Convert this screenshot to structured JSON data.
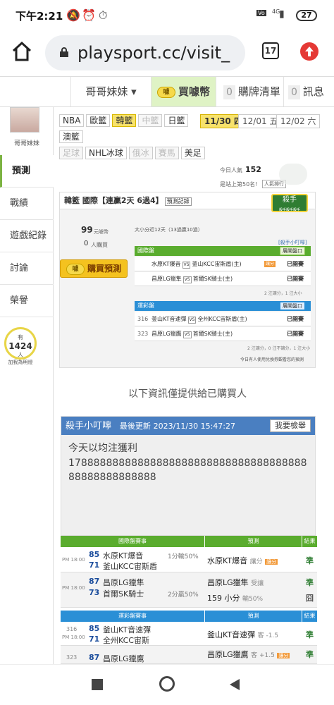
{
  "status_bar": {
    "time": "下午2:21",
    "battery": "27",
    "network": "4G"
  },
  "browser": {
    "url": "playsport.cc/visit_",
    "tab_count": "17"
  },
  "top_nav": {
    "user_menu": "哥哥妹妹 ▾",
    "buy_coins": "買噱幣",
    "buy_coins_icon_text": "噱",
    "cart_count": "0",
    "cart_label": "購牌清單",
    "msg_count": "0",
    "msg_label": "訊息"
  },
  "sidebar": {
    "username": "哥哥妹妹",
    "items": [
      {
        "label": "預測"
      },
      {
        "label": "戰績"
      },
      {
        "label": "遊戲紀錄"
      },
      {
        "label": "討論"
      },
      {
        "label": "榮譽"
      }
    ],
    "fans_prefix": "有",
    "fans_count": "1424",
    "fans_unit": "人",
    "fans_suffix": "加我為明燈"
  },
  "sports_row1": [
    "NBA",
    "歐籃",
    "韓籃",
    "中籃",
    "日籃"
  ],
  "sports_row2": [
    "澳籃"
  ],
  "sports_row3": [
    "足球",
    "NHL冰球",
    "俄冰",
    "賽馬",
    "美足"
  ],
  "dates": [
    "11/30 四",
    "12/01 五",
    "12/02 六"
  ],
  "popularity": {
    "label": "今日人氣",
    "value": "152",
    "rank_text": "是站上第50名!",
    "ranking_link": "人氣排行"
  },
  "panel": {
    "league": "韓籃 國際",
    "streak": "【連贏2天 6過4】",
    "record_btn": "預測記錄",
    "badge_title": "殺手",
    "badge_sub": "殺手殺手殺手",
    "price": "99",
    "price_unit": "元噱幣",
    "buyers": "0",
    "buyers_unit": "人購買",
    "buy_btn": "購買預測",
    "summary": "大小分近12天（13過贏10過）",
    "killer_link": "[殺手小叮嚀]",
    "intl_head": "國際盤",
    "expand1": "展開盤口",
    "intl_rows": [
      {
        "home": "水原KT爆音",
        "away": "釜山KCC宙斯盾(主)",
        "tag": "讓分",
        "status": "已開賽"
      },
      {
        "home": "昌原LG獵隼",
        "away": "首爾SK騎士(主)",
        "tag": "",
        "status": "已開賽"
      }
    ],
    "intl_foot": "2 注讓分，1 注大小",
    "sport_head": "運彩盤",
    "expand2": "展開盤口",
    "sport_rows": [
      {
        "no": "316",
        "home": "釜山KT音速彈",
        "away": "全州KCC宙斯盾(主)",
        "status": "已開賽"
      },
      {
        "no": "323",
        "home": "昌原LG獵鷹",
        "away": "首爾SK騎士(主)",
        "status": "已開賽"
      }
    ],
    "sport_foot": "2 注讓分，0 注不讓分，1 注大小",
    "footer": "今日有人使用兌換券觀看您的預測"
  },
  "notice": "以下資訊僅提供給已購買人",
  "killer": {
    "title": "殺手小叮嚀",
    "updated_label": "最後更新",
    "updated": "2023/11/30 15:47:27",
    "report_btn": "我要檢舉",
    "line1": "今天以均注獲利",
    "line2": "1788888888888888888888888888888888888888888888888888"
  },
  "intl_table": {
    "head_game": "國際盤賽事",
    "head_pred": "預測",
    "head_res": "結果",
    "rows": [
      {
        "time": "PM 18:00",
        "s1": "85",
        "t1": "水原KT爆音",
        "s2": "71",
        "t2": "釜山KCC宙斯盾",
        "extra": "1分輸50%",
        "pred": "水原KT爆音",
        "pred_note": "讓分",
        "pred_tag": "讓分",
        "res": "準"
      },
      {
        "time": "PM 18:00",
        "s1": "87",
        "t1": "昌原LG獵隼",
        "s2": "73",
        "t2": "首爾SK騎士",
        "extra": "2分贏50%",
        "pred": "昌原LG獵隼",
        "pred_note": "受讓",
        "pred2": "159 小分",
        "pred2_note": "輸50%",
        "res": "準",
        "res2": "囧"
      }
    ]
  },
  "sport_table": {
    "head_game": "運彩盤賽事",
    "head_pred": "預測",
    "head_res": "結果",
    "rows": [
      {
        "no": "316",
        "time": "PM 18:00",
        "s1": "85",
        "t1": "釜山KT音速彈",
        "s2": "71",
        "t2": "全州KCC宙斯",
        "pred": "釜山KT音速彈",
        "pred_note": "客 -1.5",
        "res": "準"
      },
      {
        "no": "323",
        "s1": "87",
        "t1": "昌原LG獵鷹",
        "pred": "昌原LG獵鷹",
        "pred_note": "客 +1.5",
        "pred_tag": "讓分",
        "res": "準"
      }
    ]
  },
  "colors": {
    "green": "#5aac2e",
    "blue": "#2a8fd6",
    "yellow": "#f7e26b",
    "accent_red": "#e53935"
  }
}
